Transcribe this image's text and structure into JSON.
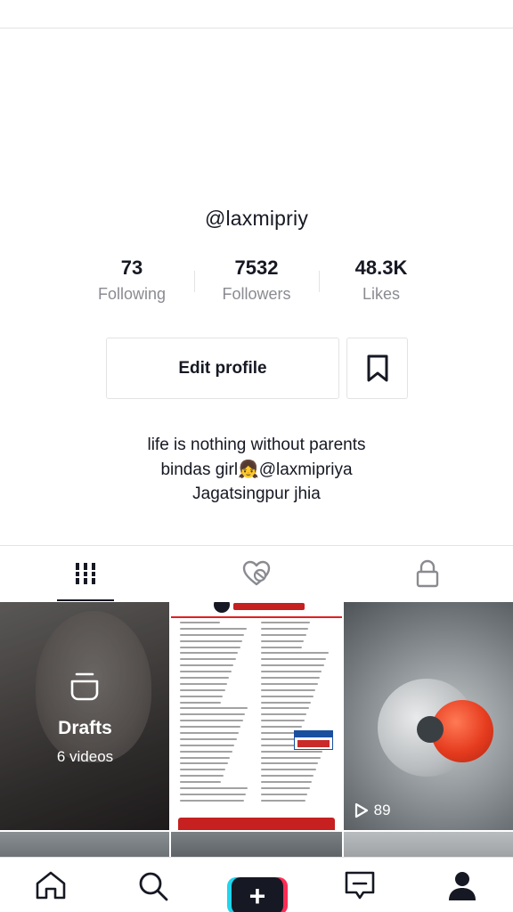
{
  "profile": {
    "username": "@laxmipriy",
    "stats": [
      {
        "value": "73",
        "label": "Following"
      },
      {
        "value": "7532",
        "label": "Followers"
      },
      {
        "value": "48.3K",
        "label": "Likes"
      }
    ],
    "edit_label": "Edit profile",
    "bio": [
      "life is nothing without parents",
      "bindas girl👧@laxmipriya",
      "Jagatsingpur  jhia"
    ]
  },
  "tabs": [
    {
      "icon": "grid-icon",
      "active": true
    },
    {
      "icon": "liked-hidden-icon",
      "active": false
    },
    {
      "icon": "lock-icon",
      "active": false
    }
  ],
  "videos": {
    "drafts": {
      "title": "Drafts",
      "count": "6 videos"
    },
    "views": "89"
  },
  "bottom_nav": [
    "home-icon",
    "search-icon",
    "create-plus-icon",
    "inbox-icon",
    "profile-icon"
  ],
  "colors": {
    "text": "#161823",
    "muted": "#8a8b91",
    "divider": "#e3e3e4",
    "accent_cyan": "#20d5ec",
    "accent_red": "#fe2c55"
  }
}
